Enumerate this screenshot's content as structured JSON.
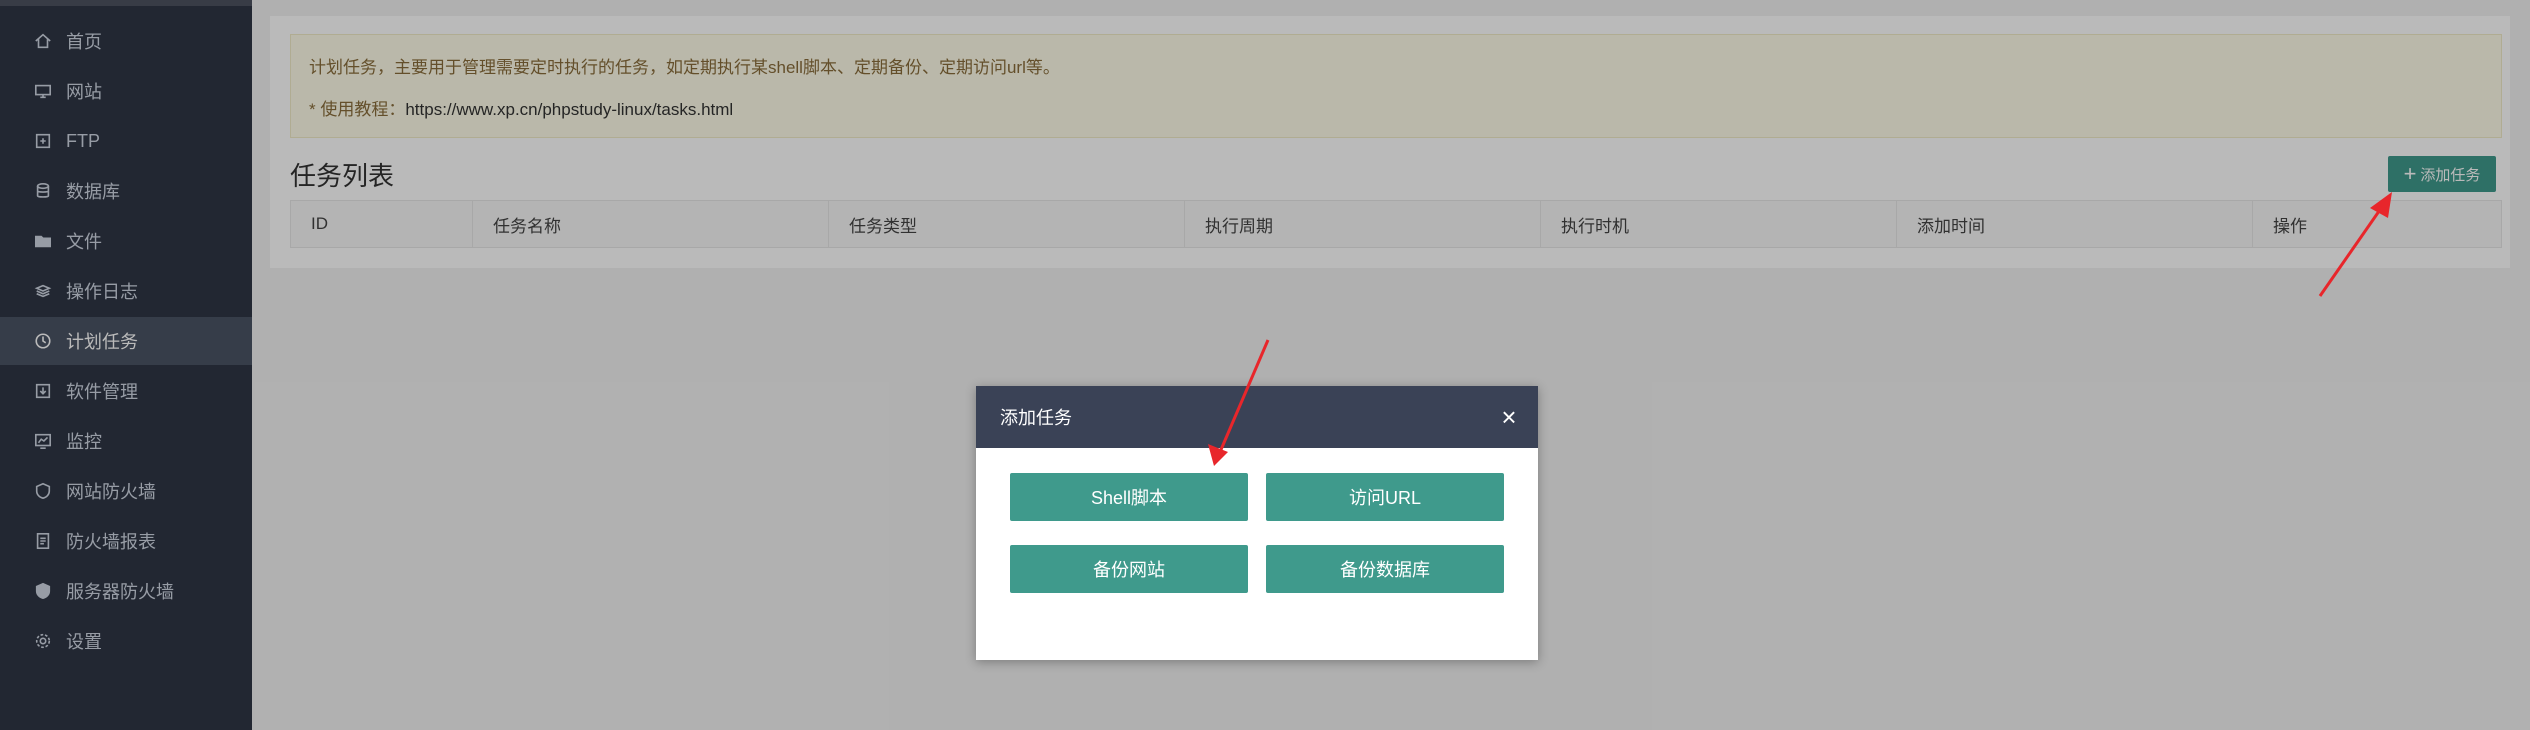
{
  "sidebar": {
    "items": [
      {
        "label": "首页",
        "icon": "home-icon"
      },
      {
        "label": "网站",
        "icon": "monitor-icon"
      },
      {
        "label": "FTP",
        "icon": "ftp-icon"
      },
      {
        "label": "数据库",
        "icon": "database-icon"
      },
      {
        "label": "文件",
        "icon": "folder-icon"
      },
      {
        "label": "操作日志",
        "icon": "layers-icon"
      },
      {
        "label": "计划任务",
        "icon": "clock-icon",
        "active": true
      },
      {
        "label": "软件管理",
        "icon": "download-icon"
      },
      {
        "label": "监控",
        "icon": "chart-icon"
      },
      {
        "label": "网站防火墙",
        "icon": "shield-icon"
      },
      {
        "label": "防火墙报表",
        "icon": "report-icon"
      },
      {
        "label": "服务器防火墙",
        "icon": "shield-check-icon"
      },
      {
        "label": "设置",
        "icon": "gear-icon"
      }
    ]
  },
  "notice": {
    "text": "计划任务，主要用于管理需要定时执行的任务，如定期执行某shell脚本、定期备份、定期访问url等。",
    "tutorial_prefix": "* 使用教程：",
    "tutorial_url": "https://www.xp.cn/phpstudy-linux/tasks.html"
  },
  "tasks": {
    "title": "任务列表",
    "add_button": "添加任务",
    "columns": [
      "ID",
      "任务名称",
      "任务类型",
      "执行周期",
      "执行时机",
      "添加时间",
      "操作"
    ]
  },
  "modal": {
    "title": "添加任务",
    "close": "×",
    "buttons": [
      "Shell脚本",
      "访问URL",
      "备份网站",
      "备份数据库"
    ]
  },
  "colors": {
    "sidebar_bg": "#2f3645",
    "accent": "#3f9a8c",
    "modal_header": "#3a4256",
    "annotation_arrow": "#e8262b"
  }
}
